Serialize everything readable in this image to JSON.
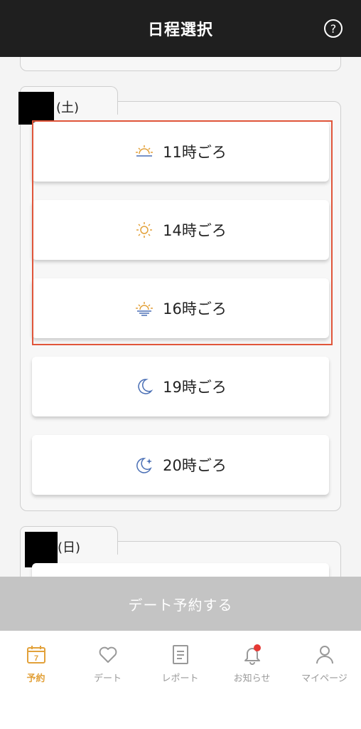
{
  "header": {
    "title": "日程選択",
    "help_icon": "?"
  },
  "days": [
    {
      "suffix": "(土)",
      "slots": [
        {
          "label": "11時ごろ",
          "icon": "sunrise-icon"
        },
        {
          "label": "14時ごろ",
          "icon": "sun-icon"
        },
        {
          "label": "16時ごろ",
          "icon": "sunset-icon"
        },
        {
          "label": "19時ごろ",
          "icon": "moon-icon"
        },
        {
          "label": "20時ごろ",
          "icon": "moon-star-icon"
        }
      ]
    },
    {
      "suffix": "(日)"
    }
  ],
  "cta": {
    "label": "デート予約する"
  },
  "tabbar": {
    "items": [
      {
        "label": "予約",
        "icon": "calendar-icon",
        "calendar_day": "7",
        "active": true
      },
      {
        "label": "デート",
        "icon": "heart-icon"
      },
      {
        "label": "レポート",
        "icon": "report-icon"
      },
      {
        "label": "お知らせ",
        "icon": "bell-icon",
        "has_badge": true
      },
      {
        "label": "マイページ",
        "icon": "person-icon"
      }
    ]
  },
  "colors": {
    "accent": "#e2a13a",
    "highlight": "#e0553a",
    "header_bg": "#1f1f1f",
    "moon": "#4a6fb5",
    "badge": "#e53935"
  }
}
